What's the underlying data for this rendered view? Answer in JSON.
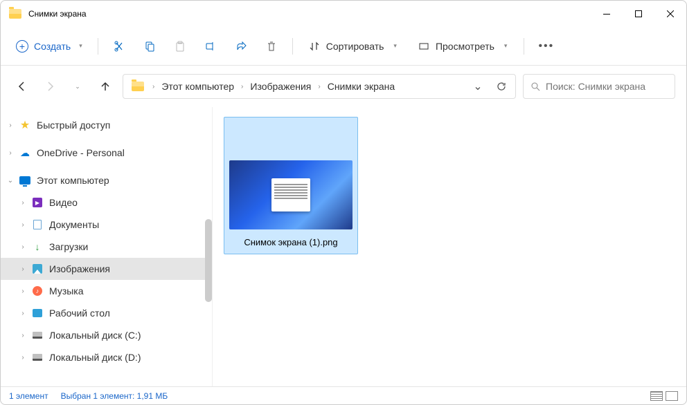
{
  "window": {
    "title": "Снимки экрана"
  },
  "toolbar": {
    "new_label": "Создать",
    "sort_label": "Сортировать",
    "view_label": "Просмотреть"
  },
  "breadcrumbs": [
    "Этот компьютер",
    "Изображения",
    "Снимки экрана"
  ],
  "search": {
    "placeholder": "Поиск: Снимки экрана"
  },
  "sidebar": [
    {
      "label": "Быстрый доступ",
      "icon": "star",
      "expandable": true,
      "expanded": false,
      "indent": 0
    },
    {
      "label": "OneDrive - Personal",
      "icon": "cloud",
      "expandable": true,
      "expanded": false,
      "indent": 0
    },
    {
      "label": "Этот компьютер",
      "icon": "monitor",
      "expandable": true,
      "expanded": true,
      "indent": 0
    },
    {
      "label": "Видео",
      "icon": "video",
      "expandable": true,
      "expanded": false,
      "indent": 1
    },
    {
      "label": "Документы",
      "icon": "doc",
      "expandable": true,
      "expanded": false,
      "indent": 1
    },
    {
      "label": "Загрузки",
      "icon": "down",
      "expandable": true,
      "expanded": false,
      "indent": 1
    },
    {
      "label": "Изображения",
      "icon": "img",
      "expandable": true,
      "expanded": false,
      "indent": 1,
      "selected": true
    },
    {
      "label": "Музыка",
      "icon": "music",
      "expandable": true,
      "expanded": false,
      "indent": 1
    },
    {
      "label": "Рабочий стол",
      "icon": "desktop",
      "expandable": true,
      "expanded": false,
      "indent": 1
    },
    {
      "label": "Локальный диск (C:)",
      "icon": "disk",
      "expandable": true,
      "expanded": false,
      "indent": 1
    },
    {
      "label": "Локальный диск (D:)",
      "icon": "disk",
      "expandable": true,
      "expanded": false,
      "indent": 1
    }
  ],
  "files": [
    {
      "name": "Снимок экрана (1).png"
    }
  ],
  "status": {
    "count": "1 элемент",
    "selection": "Выбран 1 элемент: 1,91 МБ"
  }
}
